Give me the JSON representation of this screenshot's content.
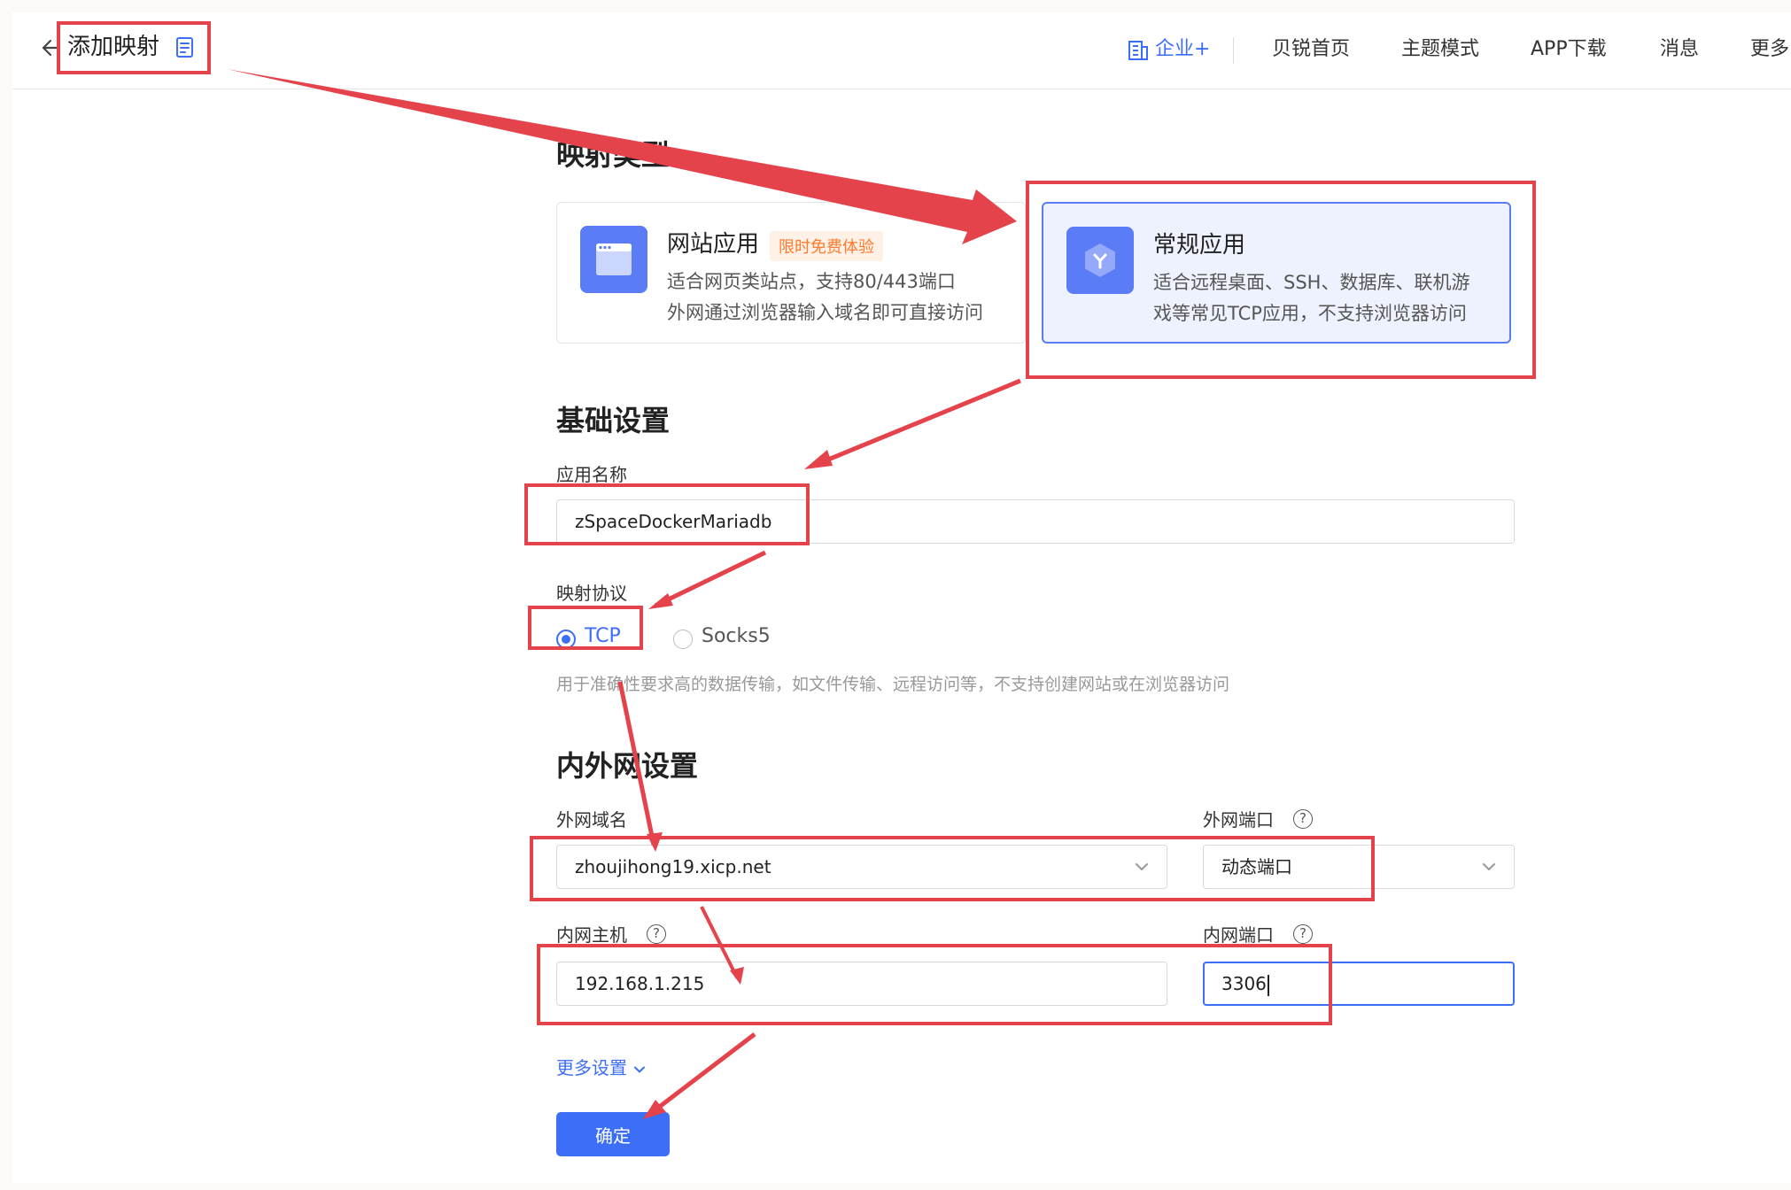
{
  "header": {
    "title": "添加映射",
    "nav": {
      "enterprise": "企业+",
      "home": "贝锐首页",
      "theme": "主题模式",
      "app_download": "APP下载",
      "messages": "消息",
      "more": "更多"
    }
  },
  "mapping_type": {
    "section_title": "映射类型",
    "website": {
      "title": "网站应用",
      "badge": "限时免费体验",
      "desc_line1": "适合网页类站点，支持80/443端口",
      "desc_line2": "外网通过浏览器输入域名即可直接访问"
    },
    "general": {
      "title": "常规应用",
      "desc_line1": "适合远程桌面、SSH、数据库、联机游",
      "desc_line2": "戏等常见TCP应用，不支持浏览器访问"
    }
  },
  "basic_settings": {
    "section_title": "基础设置",
    "app_name_label": "应用名称",
    "app_name_value": "zSpaceDockerMariadb",
    "protocol_label": "映射协议",
    "protocol_options": [
      "TCP",
      "Socks5"
    ],
    "protocol_selected": "TCP",
    "protocol_help": "用于准确性要求高的数据传输，如文件传输、远程访问等，不支持创建网站或在浏览器访问"
  },
  "network_settings": {
    "section_title": "内外网设置",
    "domain_label": "外网域名",
    "domain_value": "zhoujihong19.xicp.net",
    "ext_port_label": "外网端口",
    "ext_port_value": "动态端口",
    "lan_host_label": "内网主机",
    "lan_host_value": "192.168.1.215",
    "lan_port_label": "内网端口",
    "lan_port_value": "3306"
  },
  "more_settings": "更多设置",
  "confirm_label": "确定",
  "colors": {
    "accent": "#3d6ef7",
    "annotation": "#e4434c",
    "badge": "#ff7a2e"
  }
}
